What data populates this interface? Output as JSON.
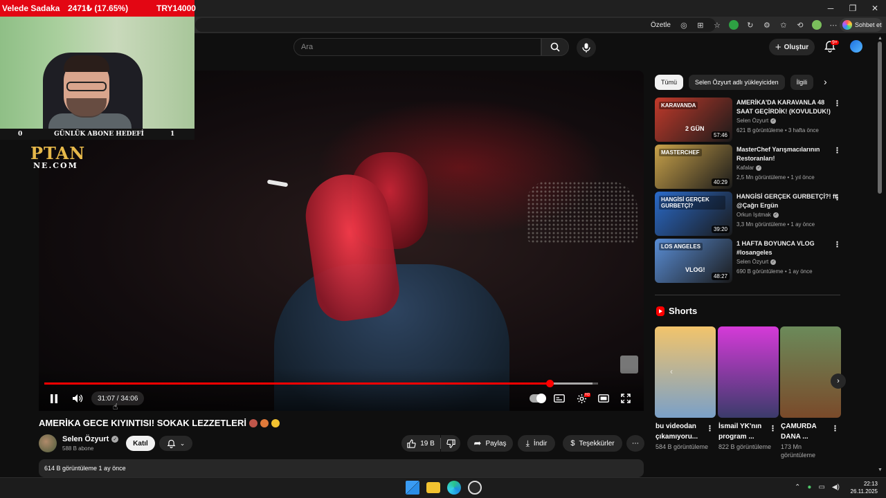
{
  "overlay": {
    "donation_label": "Velede Sadaka",
    "donation_stat": "2471₺ (17.65%)",
    "donation_target": "TRY14000",
    "goal_left": "0",
    "goal_label": "GÜNLÜK ABONE HEDEFİ",
    "goal_right": "1",
    "logo_top": "PTAN",
    "logo_bottom": "NE.COM"
  },
  "browser": {
    "summarize_label": "Özetle",
    "chat_label": "Sohbet et"
  },
  "header": {
    "search_placeholder": "Ara",
    "create_label": "Oluştur",
    "notif_badge": "9+"
  },
  "player": {
    "time": "31:07 / 34:06",
    "progress": 0.9125,
    "buffered": 0.99,
    "hd_label": "HD"
  },
  "video": {
    "title": "AMERİKA GECE KIYINTISI! SOKAK LEZZETLERİ",
    "channel": "Selen Özyurt",
    "subs": "588 B abone",
    "join": "Katıl",
    "likes": "19 B",
    "share": "Paylaş",
    "download": "İndir",
    "thanks": "Teşekkürler",
    "desc": "614 B görüntüleme  1 ay önce"
  },
  "chips": [
    "Tümü",
    "Selen Özyurt adlı yükleyiciden",
    "İlgili"
  ],
  "recommendations": [
    {
      "title": "AMERİKA'DA KARAVANLA 48 SAAT GEÇİRDİK! (KOVULDUK!)",
      "channel": "Selen Özyurt",
      "meta": "621 B görüntüleme • 3 hafta önce",
      "duration": "57:46",
      "thumb_text": "KARAVANDA",
      "thumb_sub": "2 GÜN",
      "color": "#c23a2b"
    },
    {
      "title": "MasterChef Yarışmacılarının Restoranları!",
      "channel": "Kafalar",
      "meta": "2,5 Mn görüntüleme • 1 yıl önce",
      "duration": "40:29",
      "thumb_text": "MASTERCHEF",
      "thumb_sub": "",
      "color": "#c9a24a"
    },
    {
      "title": "HANGİSİ GERÇEK GURBETÇİ?! ft. @Çağrı Ergün",
      "channel": "Orkun Işıtmak",
      "meta": "3,3 Mn görüntüleme • 1 ay önce",
      "duration": "39:20",
      "thumb_text": "HANGİSİ GERÇEK GURBETÇİ?",
      "thumb_sub": "",
      "color": "#2a6ac9"
    },
    {
      "title": "1 HAFTA BOYUNCA VLOG #losangeles",
      "channel": "Selen Özyurt",
      "meta": "690 B görüntüleme • 1 ay önce",
      "duration": "48:27",
      "thumb_text": "LOS ANGELES",
      "thumb_sub": "VLOG!",
      "color": "#5a8ed6"
    }
  ],
  "shorts": {
    "heading": "Shorts",
    "items": [
      {
        "title": "bu videodan çıkamıyoru...",
        "views": "584 B görüntüleme",
        "color1": "#f2c46b",
        "color2": "#7aa0c8"
      },
      {
        "title": "İsmail YK'nın program ...",
        "views": "822 B görüntüleme",
        "color1": "#d53ad8",
        "color2": "#3b3b6b"
      },
      {
        "title": "ÇAMURDA DANA ...",
        "views": "173 Mn görüntüleme",
        "color1": "#6b8a5a",
        "color2": "#7a4a2a"
      }
    ]
  },
  "taskbar": {
    "time": "22:13",
    "date": "26.11.2025"
  }
}
